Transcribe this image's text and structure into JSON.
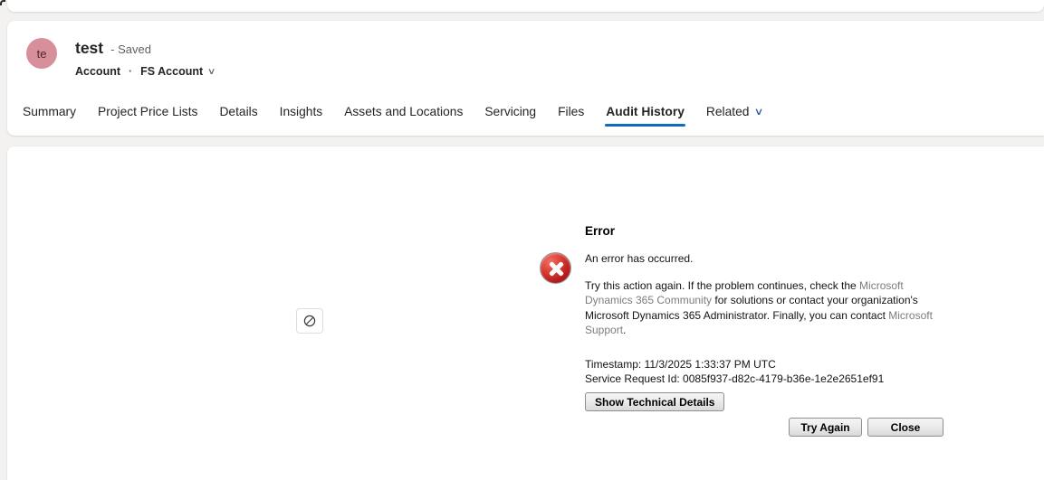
{
  "colors": {
    "accent": "#0f6cbd",
    "error_red": "#b71c1c",
    "avatar_bg": "#d7909b"
  },
  "header": {
    "avatar_initials": "te",
    "title": "test",
    "status": "- Saved",
    "entity_label": "Account",
    "dot": "·",
    "form_selector": "FS Account",
    "chevron": "∨"
  },
  "tabs": [
    {
      "label": "Summary"
    },
    {
      "label": "Project Price Lists"
    },
    {
      "label": "Details"
    },
    {
      "label": "Insights"
    },
    {
      "label": "Assets and Locations"
    },
    {
      "label": "Servicing"
    },
    {
      "label": "Files"
    },
    {
      "label": "Audit History"
    },
    {
      "label": "Related",
      "chevron": "∨"
    }
  ],
  "content": {
    "blocked_button_icon": "prohibition-icon"
  },
  "error_dialog": {
    "title": "Error",
    "summary": "An error has occurred.",
    "body": {
      "part1": "Try this action again. If the problem continues, check the ",
      "link1": "Microsoft Dynamics 365 Community",
      "part2": " for solutions or contact your organization's Microsoft Dynamics 365 Administrator. Finally, you can contact ",
      "link2": "Microsoft Support",
      "part3": "."
    },
    "timestamp": "Timestamp: 11/3/2025 1:33:37 PM UTC",
    "service_request": "Service Request Id: 0085f937-d82c-4179-b36e-1e2e2651ef91",
    "buttons": {
      "details": "Show Technical Details",
      "try_again": "Try Again",
      "close": "Close"
    }
  }
}
